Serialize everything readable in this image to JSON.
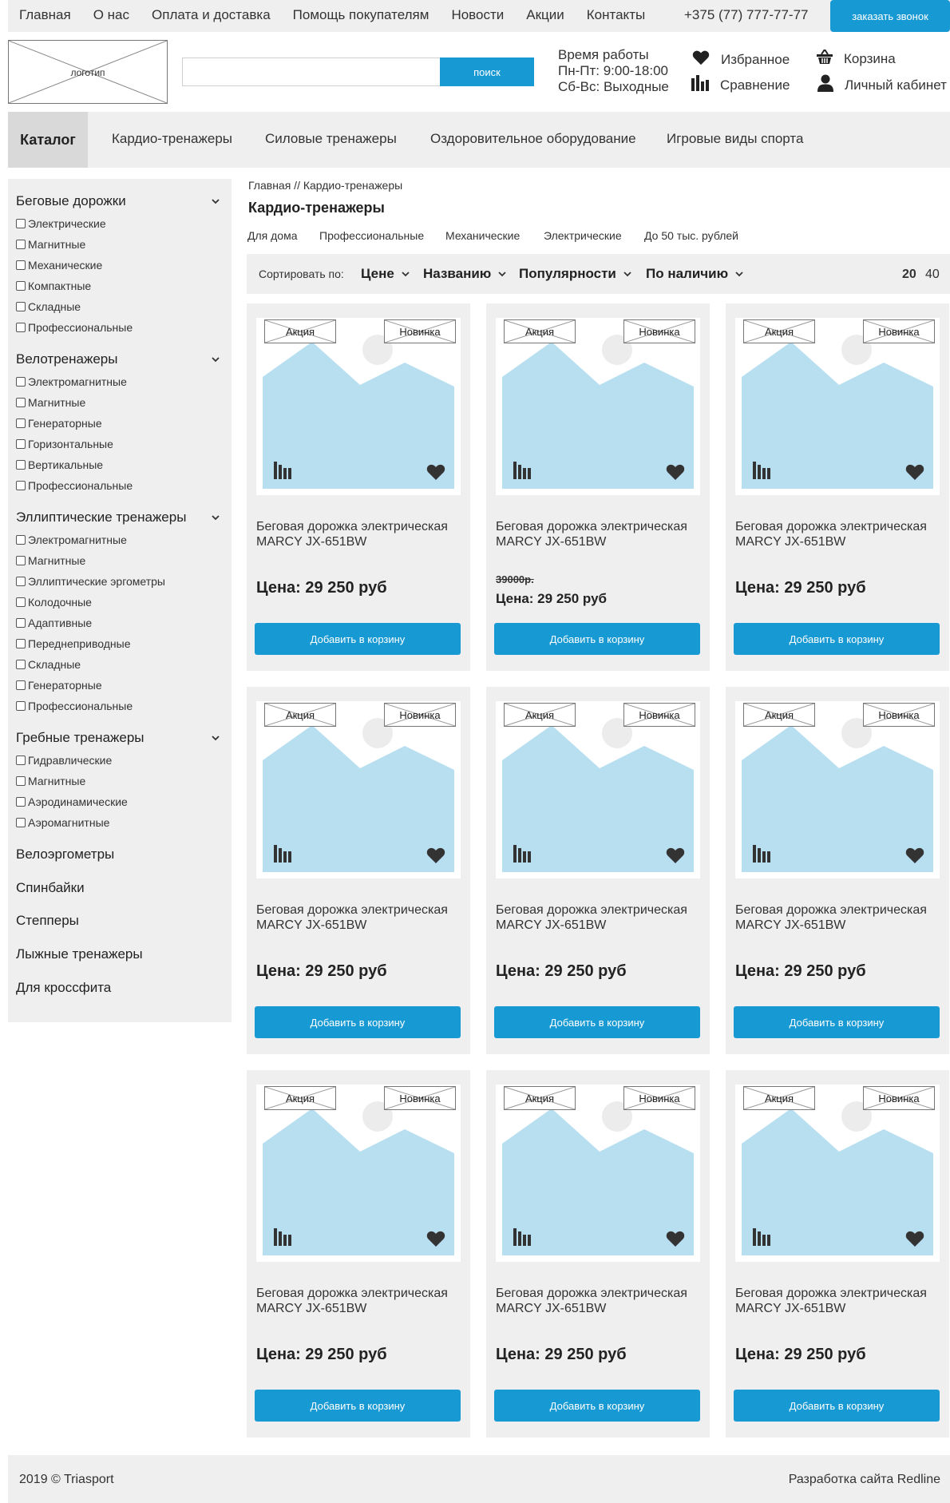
{
  "topnav": {
    "items": [
      "Главная",
      "О нас",
      "Оплата и доставка",
      "Помощь покупателям",
      "Новости",
      "Акции",
      "Контакты"
    ],
    "phone": "+375 (77) 777-77-77",
    "call_button": "заказать звонок"
  },
  "header": {
    "logo": "логотип",
    "search_placeholder": "",
    "search_button": "поиск",
    "worktime": [
      "Время работы",
      "Пн-Пт: 9:00-18:00",
      "Сб-Вс: Выходные"
    ],
    "favorites": "Избранное",
    "compare": "Сравнение",
    "cart": "Корзина",
    "account": "Личный кабинет"
  },
  "catalog_nav": {
    "active": "Каталог",
    "items": [
      "Кардио-тренажеры",
      "Силовые тренажеры",
      "Оздоровительное оборудование",
      "Игровые виды спорта"
    ]
  },
  "sidebar": {
    "groups": [
      {
        "title": "Беговые дорожки",
        "items": [
          "Электрические",
          "Магнитные",
          "Механические",
          "Компактные",
          "Складные",
          "Профессиональные"
        ]
      },
      {
        "title": "Велотренажеры",
        "items": [
          "Электромагнитные",
          "Магнитные",
          "Генераторные",
          "Горизонтальные",
          "Вертикальные",
          "Профессиональные"
        ]
      },
      {
        "title": "Эллиптические тренажеры",
        "items": [
          "Электромагнитные",
          "Магнитные",
          "Эллиптические эргометры",
          "Колодочные",
          "Адаптивные",
          "Переднеприводные",
          "Складные",
          "Генераторные",
          "Профессиональные"
        ]
      },
      {
        "title": "Гребные тренажеры",
        "items": [
          "Гидравлические",
          "Магнитные",
          "Аэродинамические",
          "Аэромагнитные"
        ]
      }
    ],
    "plain": [
      "Велоэргометры",
      "Спинбайки",
      "Степперы",
      "Лыжные тренажеры",
      "Для кроссфита"
    ]
  },
  "content": {
    "breadcrumb": "Главная // Кардио-тренажеры",
    "title": "Кардио-тренажеры",
    "subcategories": [
      "Для дома",
      "Профессиональные",
      "Механические",
      "Электрические",
      "До 50 тыс. рублей"
    ],
    "sort_label": "Сортировать по:",
    "sort_options": [
      "Цене",
      "Названию",
      "Популярности",
      "По наличию"
    ],
    "per_page": [
      "20",
      "40"
    ]
  },
  "products": [
    {
      "badge_sale": "Акция",
      "badge_new": "Новинка",
      "name": "Беговая дорожка электрическая MARCY JX-651BW",
      "old_price": "",
      "price": "Цена: 29 250 руб",
      "button": "Добавить в корзину"
    },
    {
      "badge_sale": "Акция",
      "badge_new": "Новинка",
      "name": "Беговая дорожка электрическая MARCY JX-651BW",
      "old_price": "39000р.",
      "price": "Цена: 29 250 руб",
      "button": "Добавить в корзину"
    },
    {
      "badge_sale": "Акция",
      "badge_new": "Новинка",
      "name": "Беговая дорожка электрическая MARCY JX-651BW",
      "old_price": "",
      "price": "Цена: 29 250 руб",
      "button": "Добавить в корзину"
    },
    {
      "badge_sale": "Акция",
      "badge_new": "Новинка",
      "name": "Беговая дорожка электрическая MARCY JX-651BW",
      "old_price": "",
      "price": "Цена: 29 250 руб",
      "button": "Добавить в корзину"
    },
    {
      "badge_sale": "Акция",
      "badge_new": "Новинка",
      "name": "Беговая дорожка электрическая MARCY JX-651BW",
      "old_price": "",
      "price": "Цена: 29 250 руб",
      "button": "Добавить в корзину"
    },
    {
      "badge_sale": "Акция",
      "badge_new": "Новинка",
      "name": "Беговая дорожка электрическая MARCY JX-651BW",
      "old_price": "",
      "price": "Цена: 29 250 руб",
      "button": "Добавить в корзину"
    },
    {
      "badge_sale": "Акция",
      "badge_new": "Новинка",
      "name": "Беговая дорожка электрическая MARCY JX-651BW",
      "old_price": "",
      "price": "Цена: 29 250 руб",
      "button": "Добавить в корзину"
    },
    {
      "badge_sale": "Акция",
      "badge_new": "Новинка",
      "name": "Беговая дорожка электрическая MARCY JX-651BW",
      "old_price": "",
      "price": "Цена: 29 250 руб",
      "button": "Добавить в корзину"
    },
    {
      "badge_sale": "Акция",
      "badge_new": "Новинка",
      "name": "Беговая дорожка электрическая MARCY JX-651BW",
      "old_price": "",
      "price": "Цена: 29 250 руб",
      "button": "Добавить в корзину"
    }
  ],
  "footer": {
    "copyright": "2019 © Triasport",
    "developer": "Разработка сайта Redline"
  },
  "colors": {
    "accent": "#1799d3",
    "panel": "#efefef",
    "image_placeholder": "#b8dff0"
  },
  "icons": [
    "heart-icon",
    "compare-icon",
    "cart-icon",
    "user-icon",
    "chevron-down-icon"
  ]
}
